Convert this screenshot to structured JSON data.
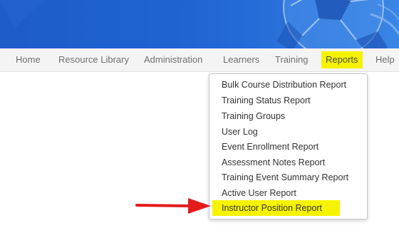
{
  "nav": {
    "items": [
      {
        "label": "Home"
      },
      {
        "label": "Resource Library"
      },
      {
        "label": "Administration"
      },
      {
        "label": "Learners"
      },
      {
        "label": "Training"
      },
      {
        "label": "Reports"
      },
      {
        "label": "Help"
      }
    ],
    "active_index": 5
  },
  "reports_menu": {
    "items": [
      {
        "label": "Bulk Course Distribution Report"
      },
      {
        "label": "Training Status Report"
      },
      {
        "label": "Training Groups"
      },
      {
        "label": "User Log"
      },
      {
        "label": "Event Enrollment Report"
      },
      {
        "label": "Assessment Notes Report"
      },
      {
        "label": "Training Event Summary Report"
      },
      {
        "label": "Active User Report"
      },
      {
        "label": "Instructor Position Report"
      }
    ],
    "highlighted_index": 8
  },
  "colors": {
    "banner": "#1f63d1",
    "highlight": "#f6f300",
    "arrow": "#e41b1b"
  },
  "icons": {
    "banner_art": "soccer-ball-icon",
    "pointer": "red-arrow-icon"
  }
}
